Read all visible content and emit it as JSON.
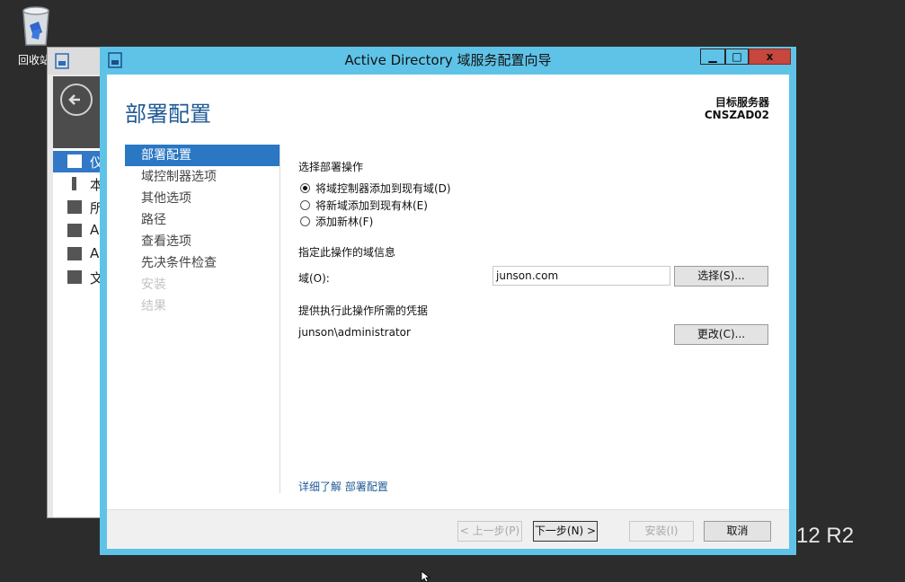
{
  "desktop": {
    "recycle_bin_label": "回收站",
    "watermark": "12 R2"
  },
  "server_manager": {
    "nav_items": [
      "仪",
      "本",
      "所",
      "A",
      "A",
      "文"
    ]
  },
  "wizard": {
    "title": "Active Directory 域服务配置向导",
    "controls": {
      "minimize": "▁",
      "maximize": "□",
      "close": "x"
    },
    "page_title": "部署配置",
    "target_server_label": "目标服务器",
    "target_server_name": "CNSZAD02",
    "steps": [
      {
        "label": "部署配置",
        "state": "active"
      },
      {
        "label": "域控制器选项",
        "state": "normal"
      },
      {
        "label": "其他选项",
        "state": "normal"
      },
      {
        "label": "路径",
        "state": "normal"
      },
      {
        "label": "查看选项",
        "state": "normal"
      },
      {
        "label": "先决条件检查",
        "state": "normal"
      },
      {
        "label": "安装",
        "state": "disabled"
      },
      {
        "label": "结果",
        "state": "disabled"
      }
    ],
    "deployment_heading": "选择部署操作",
    "options": [
      {
        "label": "将域控制器添加到现有域(D)",
        "selected": true
      },
      {
        "label": "将新域添加到现有林(E)",
        "selected": false
      },
      {
        "label": "添加新林(F)",
        "selected": false
      }
    ],
    "domain_info_heading": "指定此操作的域信息",
    "domain_label": "域(O):",
    "domain_value": "junson.com",
    "select_button": "选择(S)...",
    "credentials_heading": "提供执行此操作所需的凭据",
    "credentials_value": "junson\\administrator",
    "change_button": "更改(C)...",
    "learn_more": "详细了解 部署配置",
    "footer": {
      "prev": "< 上一步(P)",
      "next": "下一步(N) >",
      "install": "安装(I)",
      "cancel": "取消"
    }
  }
}
